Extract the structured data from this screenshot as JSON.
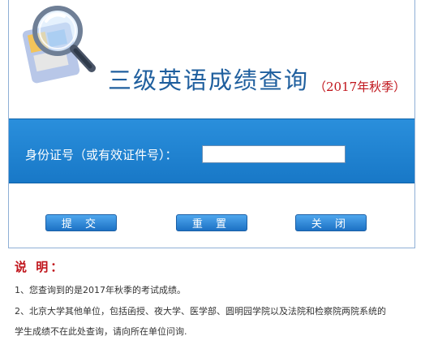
{
  "header": {
    "title": "三级英语成绩查询",
    "term": "（2017年秋季）"
  },
  "form": {
    "id_label": "身份证号（或有效证件号）：",
    "id_value": "",
    "id_placeholder": ""
  },
  "buttons": {
    "submit": "提 交",
    "reset": "重 置",
    "close": "关 闭"
  },
  "notes": {
    "title": "说 明：",
    "line1": "1、您查询到的是2017年秋季的考试成绩。",
    "line2": "2、北京大学其他单位，包括函授、夜大学、医学部、圆明园学院以及法院和检察院两院系统的",
    "line2_cont": "学生成绩不在此处查询，请向所在单位问询."
  },
  "colors": {
    "accent_blue": "#1f7fd4",
    "title_blue": "#1f5f9e",
    "alert_red": "#c0141b"
  },
  "icons": {
    "logo": "magnifier-icon"
  }
}
